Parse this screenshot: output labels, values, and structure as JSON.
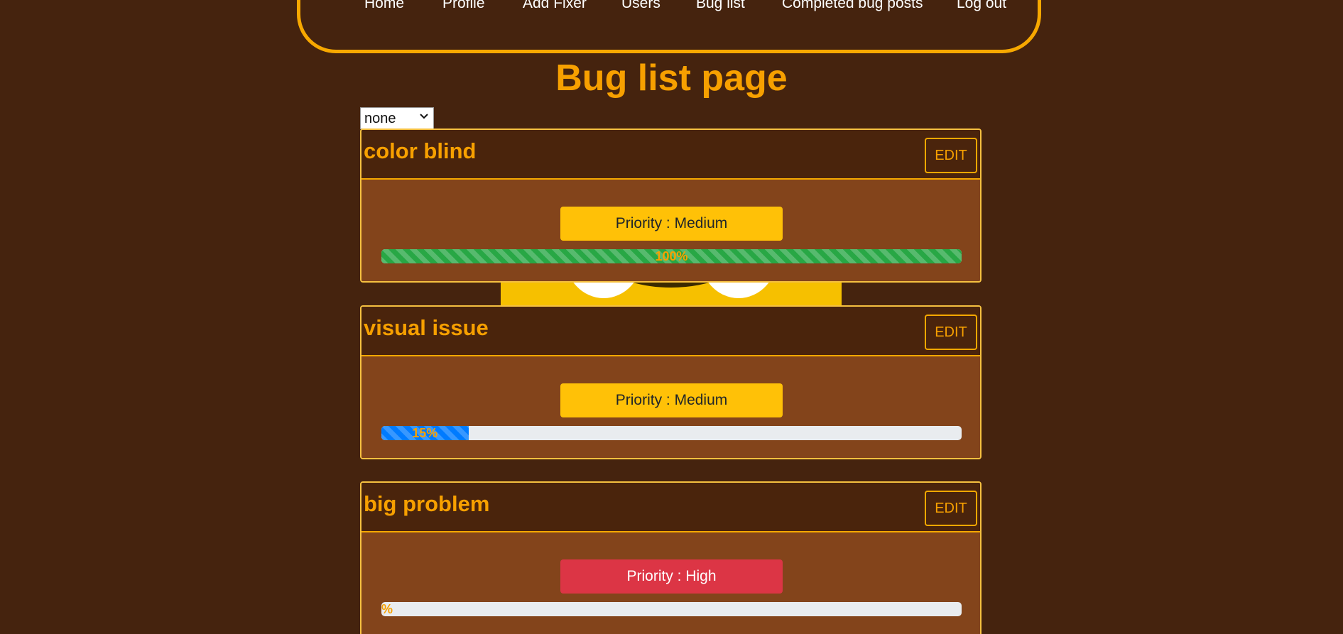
{
  "nav": {
    "links": [
      "Home",
      "Profile",
      "Add Fixer",
      "Users",
      "Bug list",
      "Completed bug posts",
      "Log out"
    ]
  },
  "page_title": "Bug list page",
  "filter": {
    "selected": "none"
  },
  "bugs": [
    {
      "title": "color blind",
      "edit_label": "EDIT",
      "priority_label": "Priority : Medium",
      "priority_level": "medium",
      "progress_percent": 100,
      "progress_label": "100%",
      "progress_color": "#28a745"
    },
    {
      "title": "visual issue",
      "edit_label": "EDIT",
      "priority_label": "Priority : Medium",
      "priority_level": "medium",
      "progress_percent": 15,
      "progress_label": "15%",
      "progress_color": "#007bff"
    },
    {
      "title": "big problem",
      "edit_label": "EDIT",
      "priority_label": "Priority : High",
      "priority_level": "high",
      "progress_percent": 0,
      "progress_label": "%",
      "progress_color": "none"
    }
  ],
  "colors": {
    "background": "#45230e",
    "accent": "#f7a000",
    "card_body": "#83441b",
    "priority_medium": "#ffc107",
    "priority_high": "#dc3545"
  },
  "icons": {
    "select": "chevron-down-icon",
    "background": "bug-logo-watermark"
  }
}
